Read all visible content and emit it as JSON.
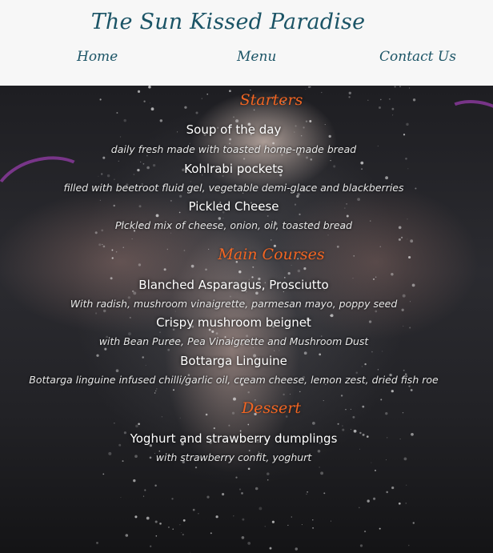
{
  "header": {
    "site_title": "The Sun Kissed Paradise",
    "nav": [
      {
        "label": "Home"
      },
      {
        "label": "Menu"
      },
      {
        "label": "Contact Us"
      }
    ]
  },
  "menu": {
    "sections": [
      {
        "title": "Starters",
        "items": [
          {
            "name": "Soup of the day",
            "description": "daily fresh made with toasted home-made bread"
          },
          {
            "name": "Kohlrabi pockets",
            "description": "filled with beetroot fluid gel, vegetable demi-glace and blackberries"
          },
          {
            "name": "Pickled Cheese",
            "description": "Pickled mix of cheese, onion, oil, toasted bread"
          }
        ]
      },
      {
        "title": "Main Courses",
        "items": [
          {
            "name": "Blanched Asparagus, Prosciutto",
            "description": "With radish, mushroom vinaigrette, parmesan mayo, poppy seed"
          },
          {
            "name": "Crispy mushroom beignet",
            "description": "with Bean Puree, Pea Vinaigrette and Mushroom Dust"
          },
          {
            "name": "Bottarga Linguine",
            "description": "Bottarga linguine infused chilli/garlic oil, cream cheese, lemon zest, dried fish roe"
          }
        ]
      },
      {
        "title": "Dessert",
        "items": [
          {
            "name": "Yoghurt and strawberry dumplings",
            "description": "with strawberry confit, yoghurt"
          }
        ]
      }
    ]
  },
  "colors": {
    "brand": "#1b5466",
    "section_title": "#f26522",
    "header_bg": "#f7f7f7"
  }
}
